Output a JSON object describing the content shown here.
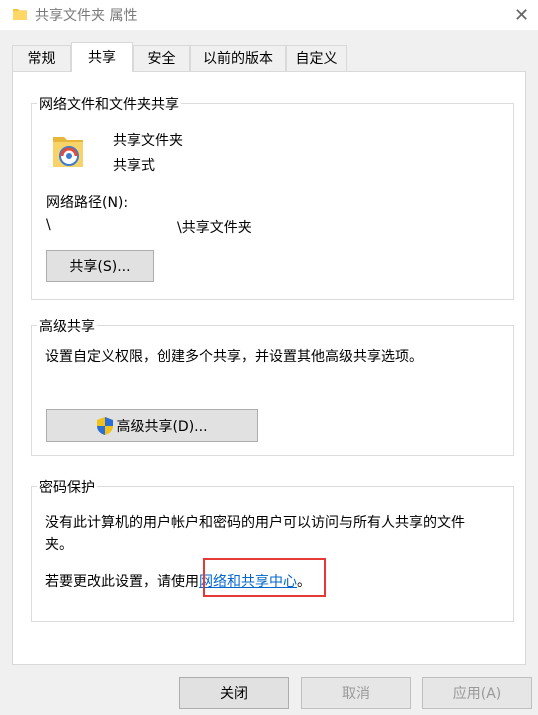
{
  "window": {
    "title": "共享文件夹 属性",
    "close_label": "✕"
  },
  "tabs": [
    {
      "label": "常规"
    },
    {
      "label": "共享"
    },
    {
      "label": "安全"
    },
    {
      "label": "以前的版本"
    },
    {
      "label": "自定义"
    }
  ],
  "active_tab": "共享",
  "network_sharing": {
    "legend": "网络文件和文件夹共享",
    "folder_name": "共享文件夹",
    "share_status": "共享式",
    "path_label": "网络路径(N):",
    "path_prefix": "\\",
    "path_suffix": "\\共享文件夹",
    "share_button": "共享(S)..."
  },
  "advanced_sharing": {
    "legend": "高级共享",
    "description": "设置自定义权限，创建多个共享，并设置其他高级共享选项。",
    "button": "高级共享(D)..."
  },
  "password_protection": {
    "legend": "密码保护",
    "description_line1": "没有此计算机的用户帐户和密码的用户可以访问与所有人共享的文件",
    "description_line2": "夹。",
    "change_prefix": "若要更改此设置，请使用",
    "link_text": "网络和共享中心",
    "change_suffix": "。"
  },
  "footer": {
    "close_button": "关闭",
    "cancel_button": "取消",
    "apply_button": "应用(A)"
  },
  "colors": {
    "link": "#0066cc",
    "highlight_box": "#e53935",
    "dialog_bg": "#f0f0f0"
  }
}
